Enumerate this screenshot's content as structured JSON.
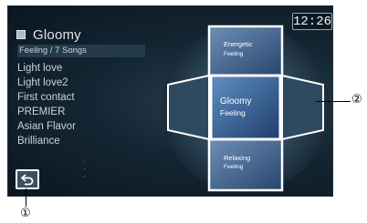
{
  "clock": "12:26",
  "mood": {
    "title": "Gloomy",
    "subtitle": "Feeling / 7 Songs"
  },
  "songs": [
    "Light love",
    "Light love2",
    "First contact",
    "PREMIER",
    "Asian Flavor",
    "Brilliance"
  ],
  "cube": {
    "top": {
      "line1": "Energetic",
      "line2": "Feeling"
    },
    "center": {
      "line1": "Gloomy",
      "line2": "Feeling"
    },
    "bottom": {
      "line1": "Relaxing",
      "line2": "Feeling"
    }
  },
  "callouts": {
    "back": "①",
    "cube": "②"
  },
  "colors": {
    "highlight": "#ffffff",
    "background": "#0b1620",
    "tile": "#3a5d86"
  },
  "icons": {
    "title": "mood-square-icon",
    "back": "back-arrow-icon"
  }
}
